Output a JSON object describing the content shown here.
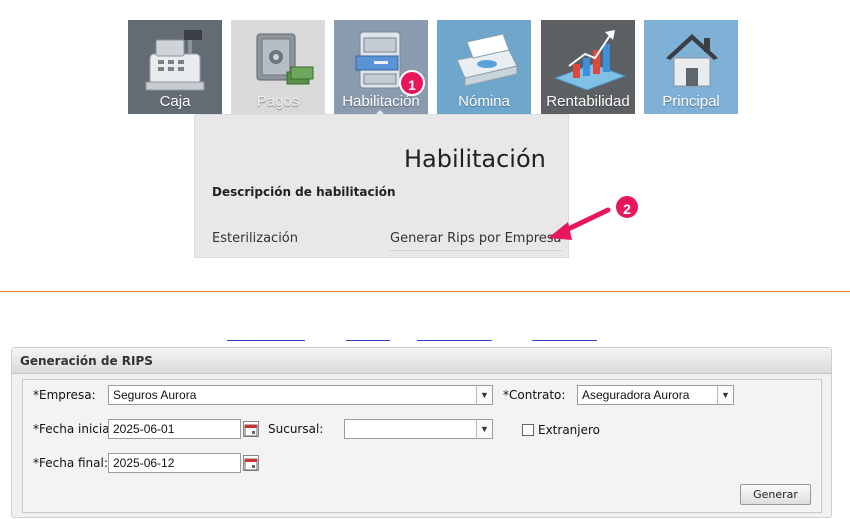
{
  "menu": {
    "tiles": [
      {
        "label": "Caja",
        "icon": "cash-register-icon"
      },
      {
        "label": "Pagos",
        "icon": "safe-icon"
      },
      {
        "label": "Habilitación",
        "icon": "filing-cabinet-icon"
      },
      {
        "label": "Nómina",
        "icon": "printer-icon"
      },
      {
        "label": "Rentabilidad",
        "icon": "growth-chart-icon"
      },
      {
        "label": "Principal",
        "icon": "home-icon"
      }
    ],
    "badges": {
      "step1": "1",
      "step2": "2"
    },
    "badge_color": "#e8175d"
  },
  "dropdown": {
    "title": "Habilitación",
    "section_label": "Descripción de habilitación",
    "items": [
      "Esterilización",
      "Generar Rips por Empresa"
    ]
  },
  "form": {
    "panel_title": "Generación de RIPS",
    "empresa_label": "*Empresa:",
    "empresa_value": "Seguros Aurora",
    "contrato_label": "*Contrato:",
    "contrato_value": "Aseguradora Aurora",
    "fecha_inicial_label": "*Fecha inicial:",
    "fecha_inicial_value": "2025-06-01",
    "sucursal_label": "Sucursal:",
    "sucursal_value": "",
    "extranjero_label": "Extranjero",
    "extranjero_checked": false,
    "fecha_final_label": "*Fecha final:",
    "fecha_final_value": "2025-06-12",
    "submit_label": "Generar"
  },
  "colors": {
    "accent_line": "#e6843e",
    "link": "#2b45c4"
  }
}
